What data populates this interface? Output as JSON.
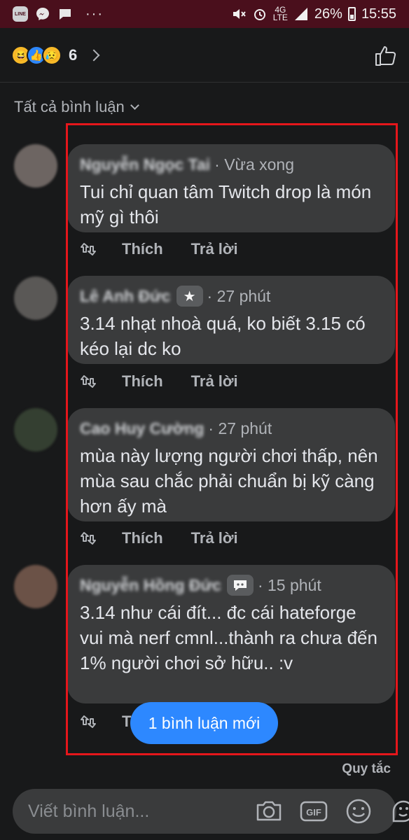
{
  "status_bar": {
    "app_icon_label": "LINE",
    "network": "4G",
    "network_sub": "LTE",
    "battery": "26%",
    "time": "15:55"
  },
  "reactions": {
    "count": "6"
  },
  "filter": {
    "label": "Tất cả bình luận"
  },
  "comments": [
    {
      "name": "Nguyễn Ngọc Tai",
      "time": "Vừa xong",
      "text": "Tui chỉ quan tâm Twitch drop là món mỹ gì thôi",
      "like": "Thích",
      "reply": "Trả lời"
    },
    {
      "name": "Lê Anh Đức",
      "badge": "star-badge",
      "time": "27 phút",
      "text": "3.14 nhạt nhoà quá, ko biết 3.15 có kéo lại dc ko",
      "like": "Thích",
      "reply": "Trả lời"
    },
    {
      "name": "Cao Huy Cường",
      "time": "27 phút",
      "text": "mùa này lượng người chơi thấp, nên mùa sau chắc phải chuẩn bị kỹ càng hơn ấy mà",
      "like": "Thích",
      "reply": "Trả lời"
    },
    {
      "name": "Nguyễn Hồng Đức",
      "badge": "chat-badge",
      "time": "15 phút",
      "text": "3.14 như cái đít... đc cái hateforge vui mà nerf cmnl...thành ra chưa đến 1% người chơi sở hữu.. :v",
      "like": "T",
      "reply": ""
    }
  ],
  "new_comments_pill": "1 bình luận mới",
  "rules_link": "Quy tắc",
  "composer": {
    "placeholder": "Viết bình luận..."
  },
  "colors": {
    "highlight": "#e5161b",
    "pill": "#2d88ff",
    "status_bar": "#4a0f1c"
  }
}
